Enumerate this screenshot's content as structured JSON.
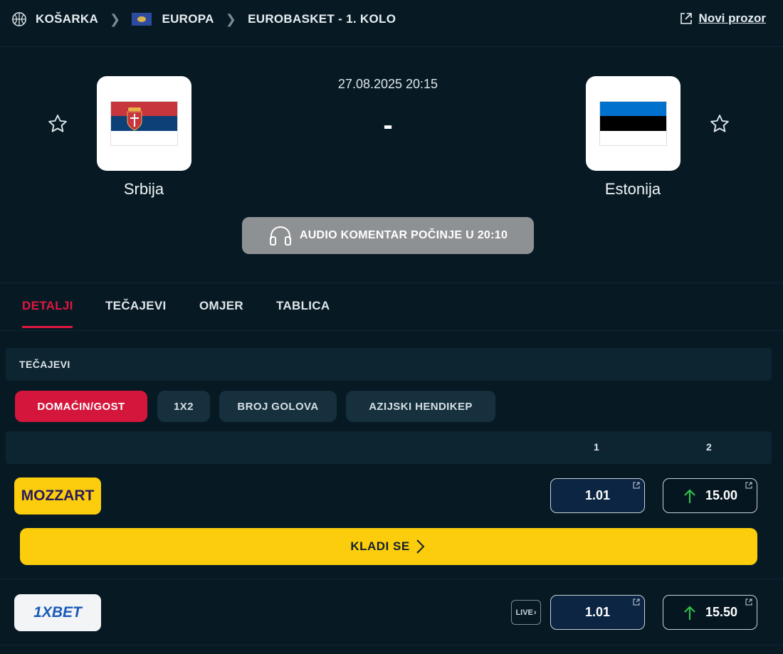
{
  "breadcrumb": {
    "sport": "KOŠARKA",
    "region": "EUROPA",
    "competition": "EUROBASKET - 1. KOLO",
    "new_window": "Novi prozor"
  },
  "match": {
    "datetime": "27.08.2025 20:15",
    "score": "-",
    "home": {
      "name": "Srbija",
      "flag_colors": [
        "#c6363c",
        "#0c4076",
        "#ffffff"
      ]
    },
    "away": {
      "name": "Estonija",
      "flag_colors": [
        "#0072ce",
        "#000000",
        "#ffffff"
      ]
    },
    "audio_label": "AUDIO KOMENTAR POČINJE U 20:10"
  },
  "tabs": [
    {
      "label": "DETALJI",
      "active": true
    },
    {
      "label": "TEČAJEVI",
      "active": false
    },
    {
      "label": "OMJER",
      "active": false
    },
    {
      "label": "TABLICA",
      "active": false
    }
  ],
  "odds": {
    "section_title": "TEČAJEVI",
    "markets": [
      {
        "label": "DOMAĆIN/GOST",
        "active": true
      },
      {
        "label": "1X2",
        "active": false
      },
      {
        "label": "BROJ GOLOVA",
        "active": false
      },
      {
        "label": "AZIJSKI HENDIKEP",
        "active": false
      }
    ],
    "columns": [
      "1",
      "2"
    ],
    "bookmakers": [
      {
        "name": "MOZZART",
        "odd1": "1.01",
        "odd2": "15.00",
        "cta": "KLADI SE"
      },
      {
        "name": "1XBET",
        "live": "LIVE",
        "odd1": "1.01",
        "odd2": "15.50"
      }
    ]
  },
  "colors": {
    "background": "#071a24",
    "accent": "#e0173f",
    "cta": "#fccd0c",
    "odds_up": "#2fbf4a"
  }
}
